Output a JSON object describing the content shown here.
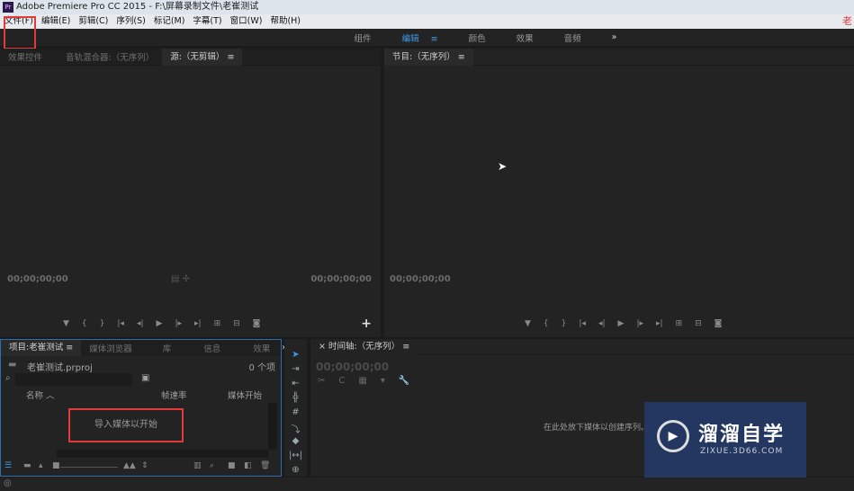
{
  "window": {
    "title": "Adobe Premiere Pro CC 2015 - F:\\屏幕录制文件\\老崔测试",
    "logo": "Pr",
    "corner": "老"
  },
  "menu": [
    "文件(F)",
    "编辑(E)",
    "剪辑(C)",
    "序列(S)",
    "标记(M)",
    "字幕(T)",
    "窗口(W)",
    "帮助(H)"
  ],
  "workspaces": {
    "items": [
      "组件",
      "编辑",
      "颜色",
      "效果",
      "音频"
    ],
    "active": 1,
    "more": "»",
    "menu": "≡"
  },
  "source_panel": {
    "tabs": [
      "效果控件",
      "音轨混合器:（无序列）",
      "源:（无剪辑）"
    ],
    "menu": "≡",
    "tc_left": "00;00;00;00",
    "tc_right": "00;00;00;00",
    "add": "+"
  },
  "program_panel": {
    "tab": "节目:（无序列）",
    "menu": "≡",
    "tc_left": "00;00;00;00"
  },
  "project_panel": {
    "tabs": [
      "项目:老崔测试",
      "媒体浏览器",
      "库",
      "信息",
      "效果"
    ],
    "menu": "≡",
    "more": "»",
    "file": "老崔测试.prproj",
    "count": "0 个项",
    "columns": [
      "名称",
      "帧速率",
      "媒体开始"
    ],
    "empty": "导入媒体以开始"
  },
  "timeline": {
    "close": "×",
    "title": "时间轴:（无序列）",
    "menu": "≡",
    "tc": "00;00;00;00",
    "empty": "在此处放下媒体以创建序列。"
  },
  "watermark": {
    "name": "溜溜自学",
    "url": "ZIXUE.3D66.COM",
    "bg": "#233760"
  },
  "colors": {
    "accent": "#3d9ae8",
    "highlight": "#e03a3a"
  }
}
